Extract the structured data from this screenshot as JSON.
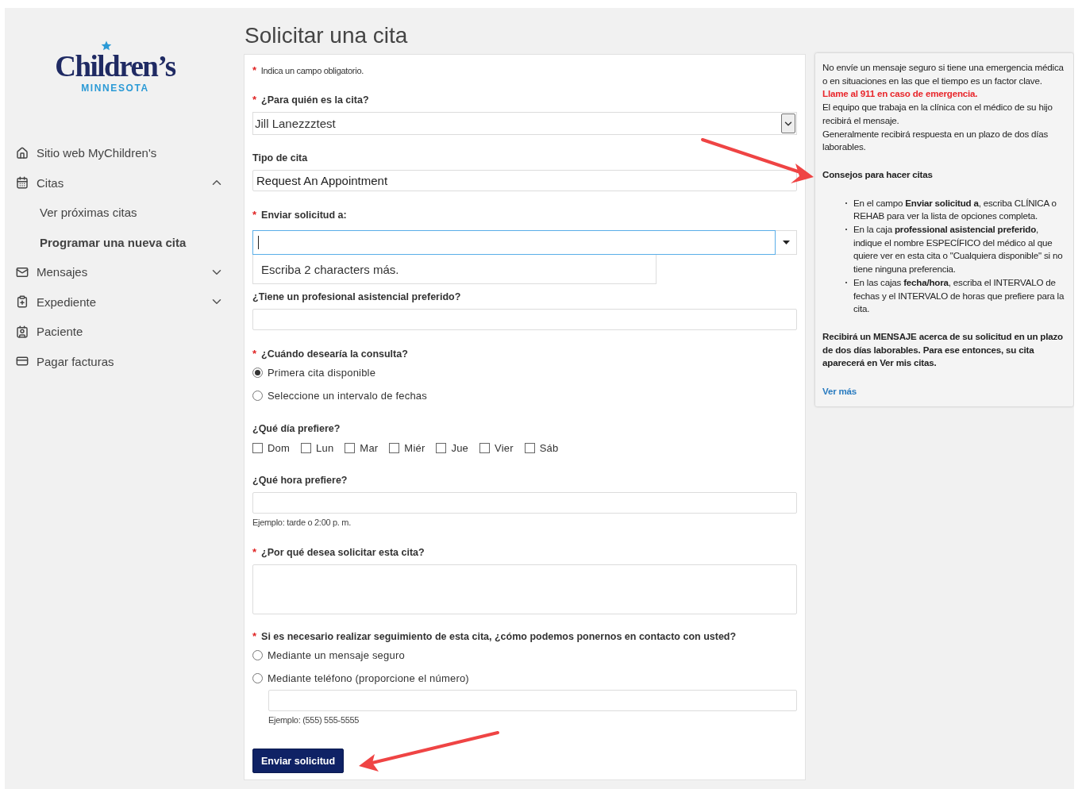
{
  "logo": {
    "name": "Children’s",
    "tagline": "MINNESOTA"
  },
  "nav": [
    {
      "label": "Sitio web MyChildren's",
      "selected": false
    },
    {
      "label": "Citas",
      "selected": false,
      "expanded": true,
      "children": [
        {
          "label": "Ver próximas citas",
          "selected": false
        },
        {
          "label": "Programar una nueva cita",
          "selected": true
        }
      ]
    },
    {
      "label": "Mensajes",
      "selected": false,
      "expanded": false
    },
    {
      "label": "Expediente",
      "selected": false,
      "expanded": false
    },
    {
      "label": "Paciente",
      "selected": false
    },
    {
      "label": "Pagar facturas",
      "selected": false
    }
  ],
  "title": "Solicitar una cita",
  "required_mark": "*",
  "required_note": "Indica un campo obligatorio.",
  "fields": [
    {
      "kind": "select",
      "label": "¿Para quién es la cita?",
      "required": true,
      "value": "Jill Lanezzztest"
    },
    {
      "kind": "text",
      "label": "Tipo de cita",
      "required": false,
      "value": "Request An Appointment"
    },
    {
      "kind": "combobox",
      "label": "Enviar solicitud a:",
      "required": true,
      "focused": true,
      "dropdown_message": "Escriba 2 characters más."
    },
    {
      "kind": "text",
      "label": "¿Tiene un profesional asistencial preferido?",
      "required": false
    },
    {
      "kind": "radio",
      "label": "¿Cuándo desearía la consulta?",
      "required": true,
      "options": [
        {
          "label": "Primera cita disponible",
          "selected": true
        },
        {
          "label": "Seleccione un intervalo de fechas",
          "selected": false
        }
      ]
    },
    {
      "kind": "checkboxes",
      "label": "¿Qué día prefiere?",
      "required": false,
      "options": [
        {
          "label": "Dom",
          "checked": false
        },
        {
          "label": "Lun",
          "checked": false
        },
        {
          "label": "Mar",
          "checked": false
        },
        {
          "label": "Miér",
          "checked": false
        },
        {
          "label": "Jue",
          "checked": false
        },
        {
          "label": "Vier",
          "checked": false
        },
        {
          "label": "Sáb",
          "checked": false
        }
      ]
    },
    {
      "kind": "text",
      "label": "¿Qué hora prefiere?",
      "required": false,
      "hint": "Ejemplo: tarde o 2:00 p. m."
    },
    {
      "kind": "textarea",
      "label": "¿Por qué desea solicitar esta cita?",
      "required": true
    },
    {
      "kind": "radio",
      "label": "Si es necesario realizar seguimiento de esta cita, ¿cómo podemos ponernos en contacto con usted?",
      "required": true,
      "options": [
        {
          "label": "Mediante un mensaje seguro",
          "selected": false
        },
        {
          "label": "Mediante teléfono (proporcione el número)",
          "selected": false,
          "input_hint": "Ejemplo: (555) 555-5555"
        }
      ]
    }
  ],
  "submit": "Enviar solicitud",
  "info": {
    "warning": "No envíe un mensaje seguro si tiene una emergencia médica o en situaciones en las que el tiempo es un factor clave.",
    "alert": "Llame al 911 en caso de emergencia.",
    "lines": [
      "El equipo que trabaja en la clínica con el médico de su hijo recibirá el mensaje.",
      "Generalmente recibirá respuesta en un plazo de dos días laborables."
    ],
    "tips_title": "Consejos para hacer citas",
    "tips": [
      "En el campo **Enviar solicitud a**, escriba CLÍNICA o REHAB para ver la lista de opciones completa.",
      "En la caja **professional asistencial preferido**, indique el nombre ESPECÍFICO del médico al que quiere ver en esta cita o \"Cualquiera disponible\" si no tiene ninguna preferencia.",
      "En las cajas **fecha/hora**, escriba el INTERVALO de fechas y el INTERVALO de horas que prefiere para la cita."
    ],
    "closing": "Recibirá un MENSAJE acerca de su solicitud en un plazo de dos días laborables. Para ese entonces, su cita aparecerá en Ver mis citas.",
    "link": "Ver más"
  }
}
